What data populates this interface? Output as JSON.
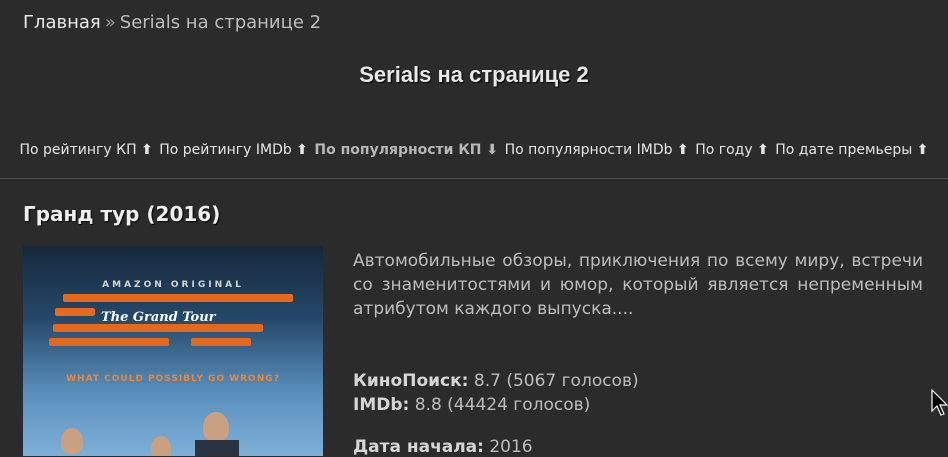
{
  "breadcrumb": {
    "home": "Главная",
    "separator": "»",
    "current": "Serials на странице 2"
  },
  "page_title": "Serials на странице 2",
  "sort_options": [
    {
      "label": "По рейтингу КП",
      "arrow": "⬆",
      "active": false
    },
    {
      "label": "По рейтингу IMDb",
      "arrow": "⬆",
      "active": false
    },
    {
      "label": "По популярности КП",
      "arrow": "⬇",
      "active": true
    },
    {
      "label": "По популярности IMDb",
      "arrow": "⬆",
      "active": false
    },
    {
      "label": "По году",
      "arrow": "⬆",
      "active": false
    },
    {
      "label": "По дате премьеры",
      "arrow": "⬆",
      "active": false
    }
  ],
  "item": {
    "title": "Гранд тур (2016)",
    "poster": {
      "brand": "AMAZON ORIGINAL",
      "logo": "The Grand Tour",
      "tagline": "WHAT COULD POSSIBLY GO WRONG?"
    },
    "description": "Автомобильные обзоры, приключения по всему миру, встречи со знаменитостями и юмор, который является непременным атрибутом каждого выпуска....",
    "ratings": {
      "kp_label": "КиноПоиск:",
      "kp_value": "8.7 (5067 голосов)",
      "imdb_label": "IMDb:",
      "imdb_value": "8.8 (44424 голосов)"
    },
    "partial_line": {
      "label": "Дата начала:",
      "value": "2016"
    }
  },
  "colors": {
    "background": "#2b2b2b",
    "accent": "#e4691d"
  }
}
